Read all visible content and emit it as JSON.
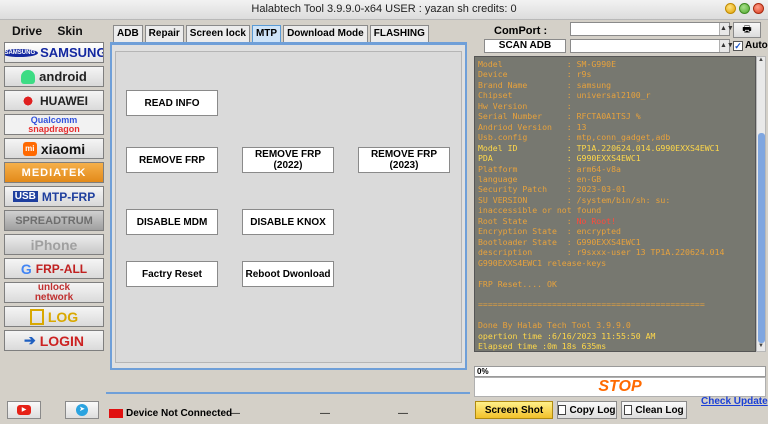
{
  "window": {
    "title": "Halabtech Tool 3.9.9.0-x64   USER : yazan sh  credits: 0"
  },
  "menu": {
    "drive": "Drive",
    "skin": "Skin"
  },
  "brands": [
    {
      "label": "SAMSUNG",
      "icon": "samsung-logo"
    },
    {
      "label": "android",
      "icon": "android-icon"
    },
    {
      "label": "HUAWEI",
      "icon": "huawei-icon"
    },
    {
      "label": "Qualcomm",
      "sub": "snapdragon",
      "icon": "snapdragon-icon"
    },
    {
      "label": "xiaomi",
      "icon": "mi-icon"
    },
    {
      "label": "MEDIATEK",
      "icon": "mediatek-logo"
    },
    {
      "label": "MTP-FRP",
      "prefix": "USB",
      "icon": "usb-icon"
    },
    {
      "label": "SPREADTRUM",
      "icon": "spreadtrum-icon"
    },
    {
      "label": "iPhone",
      "icon": "apple-icon"
    },
    {
      "label": "FRP-ALL",
      "icon": "google-icon"
    },
    {
      "label": "unlock",
      "sub": "network",
      "icon": "unlock-icon"
    },
    {
      "label": "LOG",
      "icon": "log-icon"
    },
    {
      "label": "LOGIN",
      "icon": "login-icon"
    }
  ],
  "tabs": [
    "ADB",
    "Repair",
    "Screen lock",
    "MTP",
    "Download Mode",
    "FLASHING"
  ],
  "active_tab": "MTP",
  "buttons": {
    "read_info": "READ INFO",
    "remove_frp": "REMOVE FRP",
    "remove_frp_2022_l1": "REMOVE FRP",
    "remove_frp_2022_l2": "(2022)",
    "remove_frp_2023_l1": "REMOVE FRP",
    "remove_frp_2023_l2": "(2023)",
    "disable_mdm": "DISABLE MDM",
    "disable_knox": "DISABLE KNOX",
    "factry_reset": "Factry Reset",
    "reboot_download": "Reboot Dwonload"
  },
  "comport": {
    "label": "ComPort :",
    "scan_adb": "SCAN ADB",
    "auto": "Auto",
    "auto_checked": true
  },
  "log_lines": [
    {
      "k": "Model             ",
      "v": "SM-G990E",
      "c": "o"
    },
    {
      "k": "Device            ",
      "v": "r9s",
      "c": "o"
    },
    {
      "k": "Brand Name        ",
      "v": "samsung",
      "c": "o"
    },
    {
      "k": "Chipset           ",
      "v": "universal2100_r",
      "c": "o"
    },
    {
      "k": "Hw Version        ",
      "v": "",
      "c": "o"
    },
    {
      "k": "Serial Number     ",
      "v": "RFCTA0A1TSJ %",
      "c": "o"
    },
    {
      "k": "Andriod Version   ",
      "v": "13",
      "c": "o"
    },
    {
      "k": "Usb.config        ",
      "v": "mtp,conn_gadget,adb",
      "c": "o"
    },
    {
      "k": "Model ID          ",
      "v": "TP1A.220624.014.G990EXXS4EWC1",
      "c": "y"
    },
    {
      "k": "PDA               ",
      "v": "G990EXXS4EWC1",
      "c": "y"
    },
    {
      "k": "Platform          ",
      "v": "arm64-v8a",
      "c": "o"
    },
    {
      "k": "language          ",
      "v": "en-GB",
      "c": "o"
    },
    {
      "k": "Security Patch    ",
      "v": "2023-03-01",
      "c": "o"
    },
    {
      "k": "SU VERSION        ",
      "v": "/system/bin/sh: su:",
      "c": "o"
    },
    {
      "k": "",
      "v": "inaccessible or not found",
      "c": "o",
      "raw": true
    },
    {
      "k": "Root State        ",
      "v": "No Root!",
      "c": "r"
    },
    {
      "k": "Encryption State  ",
      "v": "encrypted",
      "c": "o"
    },
    {
      "k": "Bootloader State  ",
      "v": "G990EXXS4EWC1",
      "c": "o"
    },
    {
      "k": "description       ",
      "v": "r9sxxx-user 13 TP1A.220624.014",
      "c": "o"
    },
    {
      "k": "",
      "v": "G990EXXS4EWC1 release-keys",
      "c": "o",
      "raw": true
    },
    {
      "k": "",
      "v": "",
      "c": "o",
      "raw": true
    },
    {
      "k": "",
      "v": "FRP Reset.... OK",
      "c": "o",
      "raw": true
    },
    {
      "k": "",
      "v": "",
      "c": "o",
      "raw": true
    },
    {
      "k": "",
      "v": "==============================================",
      "c": "o",
      "raw": true
    },
    {
      "k": "",
      "v": "",
      "c": "o",
      "raw": true
    },
    {
      "k": "",
      "v": "Done By Halab Tech Tool 3.9.9.0",
      "c": "o",
      "raw": true
    },
    {
      "k": "",
      "v": "opertion time :6/16/2023 11:55:50 AM",
      "c": "y",
      "raw": true
    },
    {
      "k": "",
      "v": "Elapsed time :0m 18s 635ms",
      "c": "y",
      "raw": true
    }
  ],
  "progress": {
    "text": "0%",
    "value": 0
  },
  "stop_label": "STOP",
  "bottom": {
    "screen_shot": "Screen Shot",
    "copy_log": "Copy Log",
    "clean_log": "Clean Log",
    "check_update": "Check Update"
  },
  "status": {
    "text": "Device Not Connected",
    "dash": "—",
    "led_color": "#e01010"
  }
}
